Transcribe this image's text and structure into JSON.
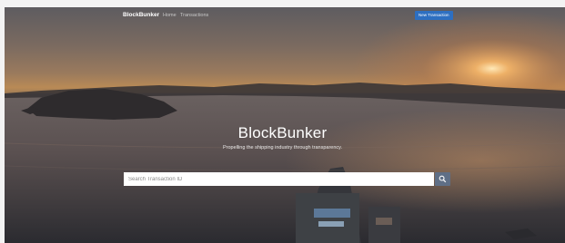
{
  "navbar": {
    "brand": "BlockBunker",
    "links": [
      "Home",
      "Transactions"
    ],
    "new_transaction_label": "New Transaction"
  },
  "hero": {
    "title": "BlockBunker",
    "subtitle": "Propelling the shipping industry through transparency."
  },
  "search": {
    "placeholder": "Search Transaction ID",
    "button_icon": "search-icon"
  },
  "colors": {
    "button_primary": "#2d6fc1",
    "search_button": "#5f6f86"
  }
}
